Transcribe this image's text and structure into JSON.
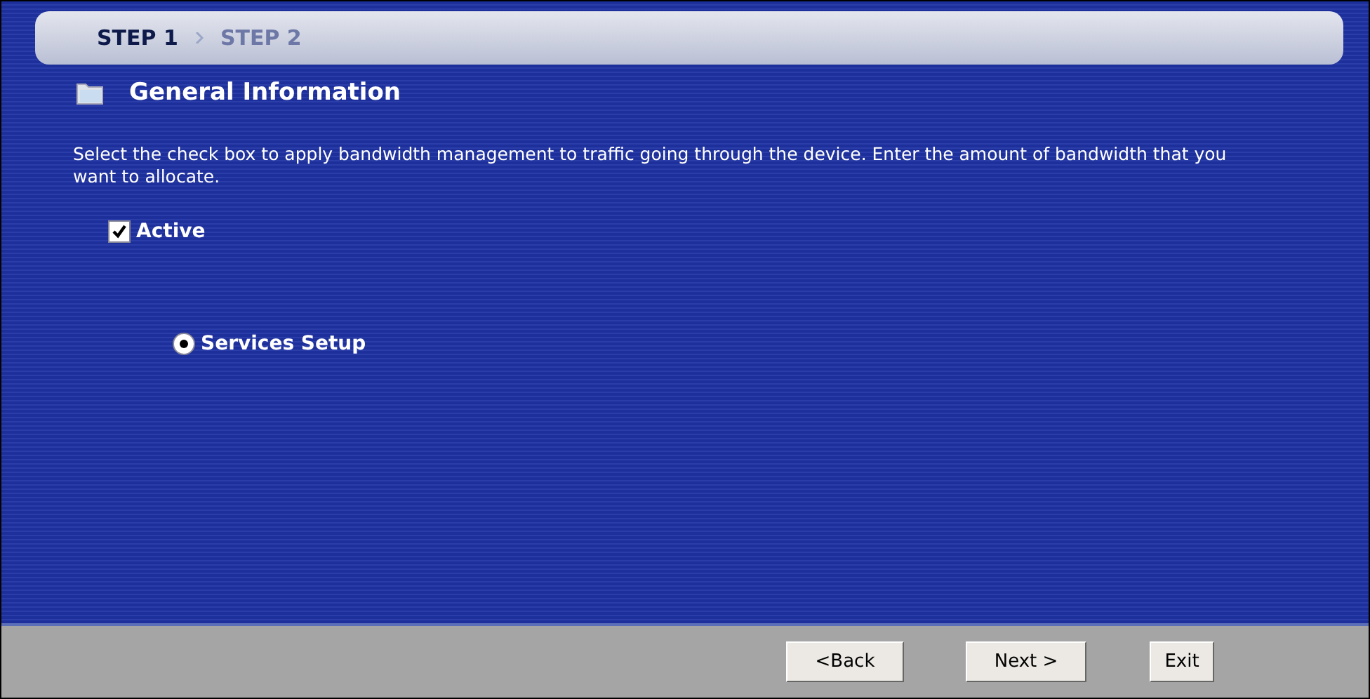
{
  "steps": [
    {
      "label": "STEP 1",
      "selected": true
    },
    {
      "label": "STEP 2",
      "selected": false
    }
  ],
  "section_title": "General Information",
  "description": "Select the check box to apply bandwidth management to traffic going through the device. Enter the amount of bandwidth that you want to allocate.",
  "active": {
    "label": "Active",
    "checked": true
  },
  "services_setup": {
    "label": "Services Setup",
    "selected": true
  },
  "buttons": [
    "<Back",
    "Next >",
    "Exit"
  ]
}
